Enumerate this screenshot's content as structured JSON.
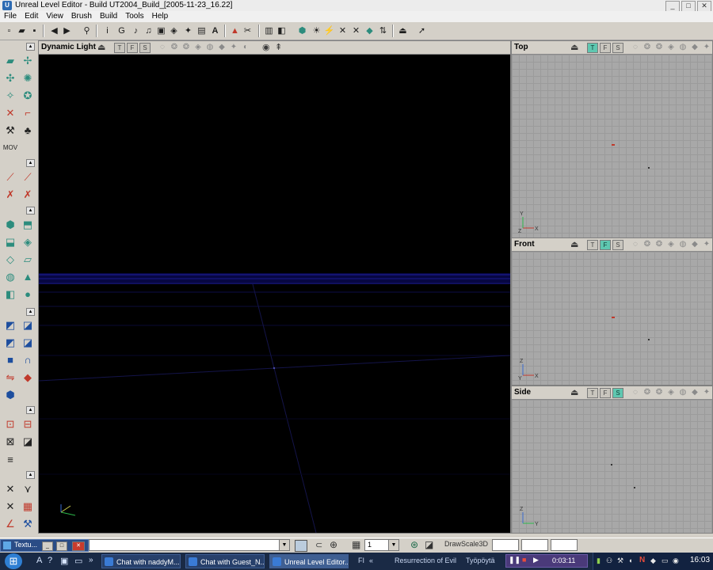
{
  "window": {
    "title": "Unreal Level Editor - Build UT2004_Build_[2005-11-23_16.22]",
    "app_icon": "U",
    "controls": {
      "minimize": "_",
      "maximize": "□",
      "close": "✕"
    }
  },
  "menu": [
    "File",
    "Edit",
    "View",
    "Brush",
    "Build",
    "Tools",
    "Help"
  ],
  "toolbar_icons": [
    "new-icon",
    "open-icon",
    "save-icon",
    "undo-icon",
    "redo-icon",
    "search-icon",
    "actor-props-icon",
    "group-icon",
    "music-icon",
    "sound-icon",
    "texture-browser-icon",
    "mesh-icon",
    "animation-icon",
    "static-mesh-icon",
    "font-icon",
    "prefab-icon",
    "cut-icon",
    "paste-icon",
    "level-icon",
    "build-geometry-icon",
    "build-lighting-icon",
    "build-paths-icon",
    "build-all-icon",
    "play-icon",
    "mode-arrow-icon",
    "camera-icon"
  ],
  "viewports": {
    "perspective": {
      "label": "Dynamic Light",
      "btn_t": "T",
      "btn_f": "F",
      "btn_s": "S"
    },
    "top": {
      "label": "Top",
      "btn_t": "T",
      "btn_f": "F",
      "btn_s": "S",
      "active": "T",
      "axis_x": "X",
      "axis_y": "Y",
      "axis_z": "Z"
    },
    "front": {
      "label": "Front",
      "btn_t": "T",
      "btn_f": "F",
      "btn_s": "S",
      "active": "F",
      "axis_x": "X",
      "axis_y": "Y",
      "axis_z": "Z"
    },
    "side": {
      "label": "Side",
      "btn_t": "T",
      "btn_f": "F",
      "btn_s": "S",
      "active": "S",
      "axis_y": "Y",
      "axis_z": "Z"
    }
  },
  "status_bar": {
    "task_label": "Textu...",
    "grid_value": "1",
    "drawscale_label": "DrawScale3D"
  },
  "taskbar": {
    "items": [
      {
        "label": "Chat with naddyM..."
      },
      {
        "label": "Chat with Guest_N..."
      },
      {
        "label": "Unreal Level Editor..."
      }
    ],
    "fi_label": "FI",
    "media_label": "Resurrection of Evil",
    "desktop_label": "Työpöytä",
    "media_time": "0:03:11",
    "clock": "16:03"
  }
}
